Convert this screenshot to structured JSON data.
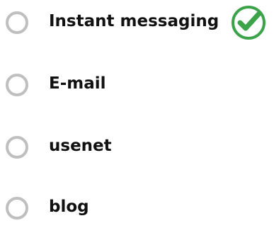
{
  "question": {
    "options": [
      {
        "label": "Instant messaging",
        "selected": false,
        "correct": true
      },
      {
        "label": "E-mail",
        "selected": false,
        "correct": false
      },
      {
        "label": "usenet",
        "selected": false,
        "correct": false
      },
      {
        "label": "blog",
        "selected": false,
        "correct": false
      }
    ],
    "correct_indicator": {
      "icon": "check-circle-icon",
      "color": "#3da34a"
    },
    "radio_color": "#bfbfbf"
  }
}
